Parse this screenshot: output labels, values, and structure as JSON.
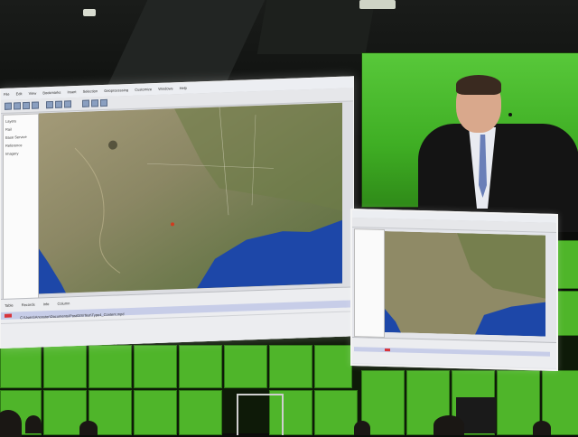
{
  "photo": {
    "main_screen": {
      "menu": [
        "File",
        "Edit",
        "View",
        "Bookmarks",
        "Insert",
        "Selection",
        "Geoprocessing",
        "Customize",
        "Windows",
        "Help"
      ],
      "toc_items": [
        "Layers",
        "Rail",
        "Base Service",
        "Reference",
        "Imagery"
      ],
      "table_tabs": [
        "Table",
        "Records",
        "Info",
        "Column"
      ],
      "path_text": "C:\\Users\\Ancestor\\Documents\\PostGIS\\Test\\Type4_Content.mpd"
    },
    "colors": {
      "screen_green": "#4fb52a",
      "land": "#8c8468",
      "ocean": "#1d47a8",
      "shirt": "#e9ebf1",
      "tie": "#6a7fb8"
    }
  }
}
